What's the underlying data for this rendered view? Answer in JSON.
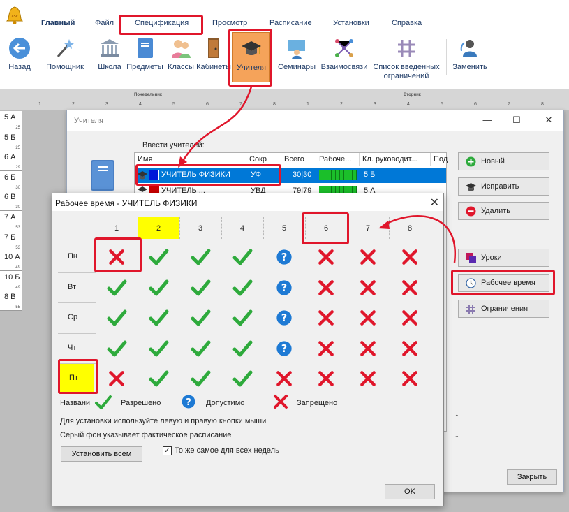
{
  "ribbon": {
    "menu": [
      "Главный",
      "Файл",
      "Спецификация",
      "Просмотр",
      "Расписание",
      "Установки",
      "Справка"
    ],
    "buttons": {
      "back": "Назад",
      "wizard": "Помощник",
      "school": "Школа",
      "subjects": "Предметы",
      "classes": "Классы",
      "rooms": "Кабинеты",
      "teachers": "Учителя",
      "seminars": "Семинары",
      "relations": "Взаимосвязи",
      "constraints_list_l1": "Список введенных",
      "constraints_list_l2": "ограничений",
      "replace": "Заменить"
    }
  },
  "background_grid": {
    "day1": "Понедельник",
    "day2": "Вторник",
    "periods": [
      "1",
      "2",
      "3",
      "4",
      "5",
      "6",
      "7",
      "8",
      "1",
      "2",
      "3",
      "4",
      "5",
      "6",
      "7",
      "8"
    ],
    "rows": [
      {
        "label": "5 А",
        "num": "25"
      },
      {
        "label": "5 Б",
        "num": "25"
      },
      {
        "label": "6 А",
        "num": "29"
      },
      {
        "label": "6 Б",
        "num": "30"
      },
      {
        "label": "6 В",
        "num": "30"
      },
      {
        "label": "7 А",
        "num": "53"
      },
      {
        "label": "7 Б",
        "num": "53"
      },
      {
        "label": "10 А",
        "num": "49"
      },
      {
        "label": "10 Б",
        "num": "49"
      },
      {
        "label": "8 В",
        "num": "55"
      }
    ]
  },
  "teachers_window": {
    "title": "Учителя",
    "list_label": "Ввести учителей:",
    "columns": [
      "Имя",
      "Сокр",
      "Всего",
      "Рабоче...",
      "Кл. руководит...",
      "Под"
    ],
    "rows": [
      {
        "name": "УЧИТЕЛЬ ФИЗИКИ",
        "short": "УФ",
        "total": "30|30",
        "class": "5 Б"
      },
      {
        "name": "УЧИТЕЛЬ ...",
        "short": "УВД",
        "total": "79|79",
        "class": "5 А"
      }
    ],
    "buttons": {
      "new": "Новый",
      "edit": "Исправить",
      "delete": "Удалить",
      "lessons": "Уроки",
      "worktime": "Рабочее время",
      "constraints": "Ограничения",
      "close": "Закрыть"
    },
    "colors": {
      "selection": "#0078d7",
      "accent_red": "#e0162b"
    }
  },
  "worktime_dialog": {
    "title": "Рабочее время - УЧИТЕЛЬ ФИЗИКИ",
    "periods": [
      "1",
      "2",
      "3",
      "4",
      "5",
      "6",
      "7",
      "8"
    ],
    "highlighted_period": "2",
    "days": [
      "Пн",
      "Вт",
      "Ср",
      "Чт",
      "Пт"
    ],
    "highlighted_day": "Пт",
    "grid": [
      [
        "no",
        "yes",
        "yes",
        "yes",
        "maybe",
        "no",
        "no",
        "no"
      ],
      [
        "yes",
        "yes",
        "yes",
        "yes",
        "maybe",
        "no",
        "no",
        "no"
      ],
      [
        "yes",
        "yes",
        "yes",
        "yes",
        "maybe",
        "no",
        "no",
        "no"
      ],
      [
        "yes",
        "yes",
        "yes",
        "yes",
        "maybe",
        "no",
        "no",
        "no"
      ],
      [
        "no",
        "yes",
        "yes",
        "yes",
        "no",
        "no",
        "no",
        "no"
      ]
    ],
    "legend": {
      "prefix": "Названи",
      "allowed": "Разрешено",
      "possible": "Допустимо",
      "forbidden": "Запрещено"
    },
    "hint1": "Для установки используйте левую и правую кнопки мыши",
    "hint2": "Серый фон указывает фактическое расписание",
    "set_all": "Установить всем",
    "same_all_weeks": "То же самое для всех недель",
    "ok": "OK"
  }
}
